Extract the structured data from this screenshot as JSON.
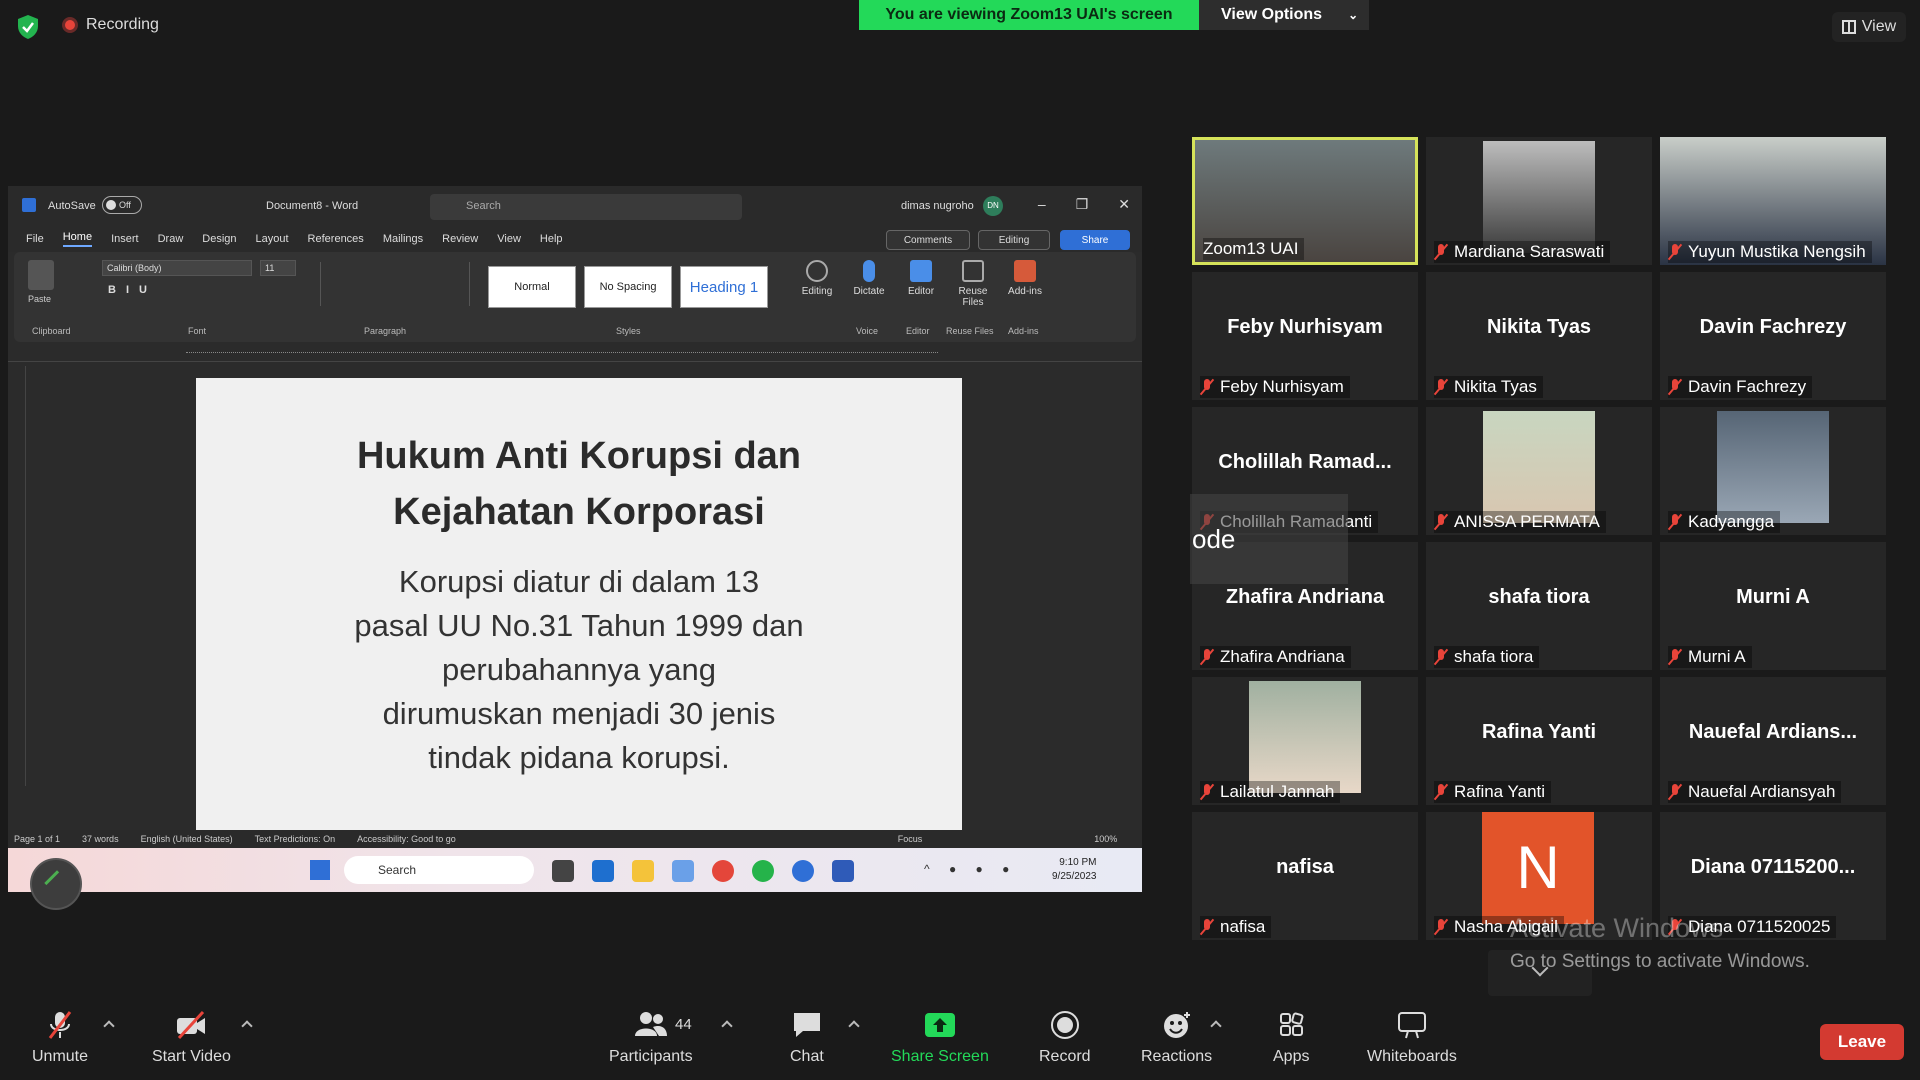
{
  "top": {
    "recording": "Recording",
    "viewing_banner": "You are viewing Zoom13 UAI's screen",
    "view_options": "View Options",
    "view": "View"
  },
  "word": {
    "autosave": "AutoSave",
    "autosave_state": "Off",
    "doc_title": "Document8 - Word",
    "search": "Search",
    "user": "dimas nugroho",
    "user_initials": "DN",
    "menu": [
      "File",
      "Home",
      "Insert",
      "Draw",
      "Design",
      "Layout",
      "References",
      "Mailings",
      "Review",
      "View",
      "Help"
    ],
    "comments": "Comments",
    "editing": "Editing",
    "share": "Share",
    "font": "Calibri (Body)",
    "size": "11",
    "styles": [
      "Normal",
      "No Spacing",
      "Heading 1"
    ],
    "groups": [
      "Clipboard",
      "Font",
      "Paragraph",
      "Styles",
      "Voice",
      "Editor",
      "Reuse Files",
      "Add-ins"
    ],
    "paste": "Paste",
    "tools": [
      "Editing",
      "Dictate",
      "Editor",
      "Reuse Files",
      "Add-ins"
    ],
    "status": [
      "Page 1 of 1",
      "37 words",
      "English (United States)",
      "Text Predictions: On",
      "Accessibility: Good to go",
      "Focus",
      "100%"
    ]
  },
  "slide": {
    "title_line1": "Hukum Anti Korupsi dan",
    "title_line2": "Kejahatan Korporasi",
    "body": [
      "Korupsi diatur di dalam 13",
      "pasal UU No.31 Tahun 1999 dan",
      "perubahannya yang",
      "dirumuskan menjadi 30 jenis",
      "tindak pidana korupsi."
    ]
  },
  "taskbar": {
    "search": "Search",
    "time": "9:10 PM",
    "date": "9/25/2023"
  },
  "participants": [
    {
      "label": "Zoom13 UAI",
      "name": "",
      "video": true
    },
    {
      "label": "Mardiana Saraswati",
      "name": "",
      "video": true
    },
    {
      "label": "Yuyun Mustika Nengsih",
      "name": "",
      "video": true
    },
    {
      "label": "Feby Nurhisyam",
      "name": "Feby Nurhisyam"
    },
    {
      "label": "Nikita Tyas",
      "name": "Nikita Tyas"
    },
    {
      "label": "Davin Fachrezy",
      "name": "Davin Fachrezy"
    },
    {
      "label": "Cholillah Ramadanti",
      "name": "Cholillah  Ramad..."
    },
    {
      "label": "ANISSA PERMATA",
      "name": "",
      "video": true
    },
    {
      "label": "Kadyangga",
      "name": "",
      "video": true
    },
    {
      "label": "Zhafira Andriana",
      "name": "Zhafira Andriana"
    },
    {
      "label": "shafa tiora",
      "name": "shafa tiora"
    },
    {
      "label": "Murni A",
      "name": "Murni A"
    },
    {
      "label": "Lailatul Jannah",
      "name": "",
      "video": true
    },
    {
      "label": "Rafina Yanti",
      "name": "Rafina Yanti"
    },
    {
      "label": "Nauefal Ardiansyah",
      "name": "Nauefal  Ardians..."
    },
    {
      "label": "nafisa",
      "name": "nafisa"
    },
    {
      "label": "Nasha Abigail",
      "name": "",
      "letter": "N"
    },
    {
      "label": "Diana 0711520025",
      "name": "Diana  07115200..."
    }
  ],
  "overlay": {
    "ode": "ode",
    "activate_title": "Activate Windows",
    "activate_sub": "Go to Settings to activate Windows."
  },
  "toolbar": {
    "unmute": "Unmute",
    "start_video": "Start Video",
    "participants": "Participants",
    "participant_count": "44",
    "chat": "Chat",
    "share_screen": "Share Screen",
    "record": "Record",
    "reactions": "Reactions",
    "apps": "Apps",
    "whiteboards": "Whiteboards",
    "leave": "Leave"
  },
  "colors": {
    "zoom_green": "#23d959",
    "leave_red": "#d33a31",
    "active_speaker": "#d6e35a"
  }
}
